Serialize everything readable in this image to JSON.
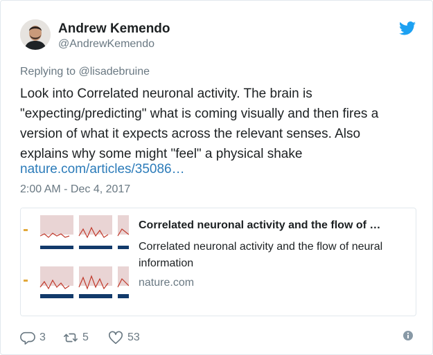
{
  "author": {
    "name": "Andrew Kemendo",
    "handle": "@AndrewKemendo"
  },
  "replying": {
    "prefix": "Replying to",
    "to": "@lisadebruine"
  },
  "tweet": {
    "text": "Look into Correlated neuronal activity. The brain is\n\"expecting/predicting\" what is coming visually and then fires a\nversion of what it expects across the relevant senses. Also\nexplains why some might \"feel\" a physical shake",
    "link": "nature.com/articles/35086…",
    "timestamp": "2:00 AM - Dec 4, 2017"
  },
  "preview": {
    "title": "Correlated neuronal activity and the flow of …",
    "description": "Correlated neuronal activity and the flow of neural information",
    "domain": "nature.com"
  },
  "actions": {
    "replies": "3",
    "retweets": "5",
    "likes": "53"
  },
  "icons": {
    "brand": "twitter-bird-icon",
    "reply": "reply-icon",
    "retweet": "retweet-icon",
    "like": "heart-icon",
    "info": "info-icon"
  },
  "colors": {
    "link": "#2b7bb9",
    "twitter_blue": "#1da1f2",
    "muted": "#697882"
  }
}
